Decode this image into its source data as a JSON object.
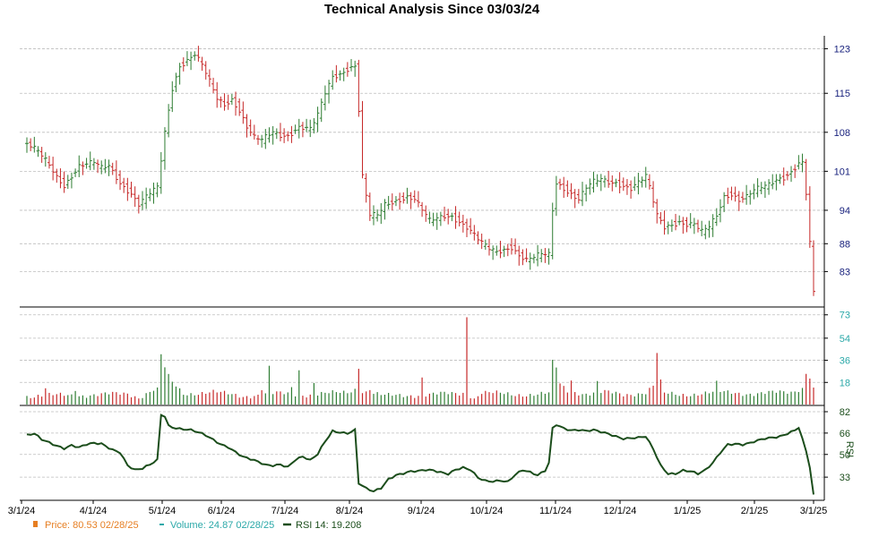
{
  "chart_data": {
    "type": "ohlc",
    "title": "Technical Analysis Since 03/03/24",
    "colors": {
      "up": "#2e7d32",
      "down": "#c62828",
      "volume_axis": "#2aa8a8",
      "price_axis": "#1a237e",
      "rsi_line": "#1b4d1b",
      "grid": "#bdbdbd",
      "legend_price": "#e67e22",
      "legend_volume": "#2aa8a8",
      "legend_rsi": "#1b4d1b"
    },
    "x_axis": {
      "ticks": [
        "3/1/24",
        "4/1/24",
        "5/1/24",
        "6/1/24",
        "7/1/24",
        "8/1/24",
        "9/1/24",
        "10/1/24",
        "11/1/24",
        "12/1/24",
        "1/1/25",
        "2/1/25",
        "3/1/25"
      ]
    },
    "price_axis": {
      "ticks": [
        "123",
        "115",
        "108",
        "101",
        "94",
        "88",
        "83"
      ],
      "tick_values": [
        123,
        115,
        108,
        101,
        94,
        88,
        83
      ],
      "ylim": [
        76.8,
        125
      ]
    },
    "volume_axis": {
      "ticks": [
        "73",
        "54",
        "36",
        "18"
      ],
      "tick_values": [
        73,
        54,
        36,
        18
      ],
      "ylim": [
        0,
        75
      ]
    },
    "rsi_axis": {
      "label": "RSI",
      "ticks": [
        "82",
        "66",
        "50",
        "33"
      ],
      "tick_values": [
        82,
        66,
        50,
        33
      ],
      "ylim": [
        17,
        82
      ]
    },
    "price_anchors": [
      [
        0,
        106
      ],
      [
        3,
        104.5
      ],
      [
        6,
        102
      ],
      [
        8,
        100
      ],
      [
        10,
        98.5
      ],
      [
        14,
        102
      ],
      [
        18,
        102.5
      ],
      [
        20,
        101.5
      ],
      [
        22,
        102
      ],
      [
        25,
        99
      ],
      [
        28,
        97
      ],
      [
        30,
        95
      ],
      [
        33,
        97
      ],
      [
        35,
        98
      ],
      [
        37,
        108
      ],
      [
        39,
        116
      ],
      [
        41,
        120
      ],
      [
        43,
        121
      ],
      [
        45,
        122
      ],
      [
        47,
        120
      ],
      [
        49,
        117
      ],
      [
        51,
        114
      ],
      [
        53,
        113
      ],
      [
        55,
        114
      ],
      [
        57,
        112
      ],
      [
        59,
        109
      ],
      [
        61,
        107
      ],
      [
        63,
        106.5
      ],
      [
        66,
        108
      ],
      [
        68,
        107.5
      ],
      [
        70,
        107.5
      ],
      [
        73,
        109
      ],
      [
        76,
        108.5
      ],
      [
        78,
        111
      ],
      [
        80,
        115
      ],
      [
        82,
        118
      ],
      [
        84,
        118.5
      ],
      [
        86,
        119.5
      ],
      [
        88,
        120
      ],
      [
        89,
        112
      ],
      [
        90,
        100
      ],
      [
        92,
        93
      ],
      [
        94,
        93
      ],
      [
        96,
        95
      ],
      [
        98,
        95.5
      ],
      [
        100,
        96
      ],
      [
        102,
        96.5
      ],
      [
        104,
        96
      ],
      [
        106,
        94
      ],
      [
        108,
        92
      ],
      [
        110,
        92.5
      ],
      [
        112,
        93
      ],
      [
        114,
        93
      ],
      [
        116,
        92
      ],
      [
        118,
        91
      ],
      [
        120,
        89.5
      ],
      [
        122,
        88
      ],
      [
        124,
        87
      ],
      [
        126,
        86.5
      ],
      [
        128,
        87
      ],
      [
        130,
        87.5
      ],
      [
        132,
        86
      ],
      [
        134,
        85
      ],
      [
        136,
        85.5
      ],
      [
        138,
        86
      ],
      [
        140,
        86
      ],
      [
        141,
        94
      ],
      [
        142,
        99
      ],
      [
        144,
        98
      ],
      [
        146,
        97
      ],
      [
        148,
        96
      ],
      [
        150,
        98
      ],
      [
        152,
        99
      ],
      [
        154,
        99.5
      ],
      [
        156,
        99
      ],
      [
        158,
        99
      ],
      [
        160,
        98.5
      ],
      [
        162,
        98
      ],
      [
        164,
        99
      ],
      [
        166,
        100
      ],
      [
        167,
        98
      ],
      [
        169,
        93
      ],
      [
        171,
        91
      ],
      [
        173,
        91.5
      ],
      [
        175,
        92
      ],
      [
        177,
        91.5
      ],
      [
        179,
        91.5
      ],
      [
        181,
        90
      ],
      [
        183,
        91
      ],
      [
        185,
        93
      ],
      [
        187,
        96.5
      ],
      [
        189,
        97
      ],
      [
        191,
        96
      ],
      [
        193,
        96.5
      ],
      [
        195,
        97.5
      ],
      [
        197,
        98
      ],
      [
        199,
        98.5
      ],
      [
        201,
        99.5
      ],
      [
        203,
        100
      ],
      [
        205,
        101
      ],
      [
        207,
        102.5
      ],
      [
        208,
        102.5
      ],
      [
        209,
        97
      ],
      [
        210,
        88
      ],
      [
        211,
        79
      ]
    ],
    "volume_anchors": [
      [
        0,
        7
      ],
      [
        20,
        8
      ],
      [
        27,
        9
      ],
      [
        30,
        6
      ],
      [
        34,
        12
      ],
      [
        36,
        12
      ],
      [
        37,
        27
      ],
      [
        39,
        18
      ],
      [
        42,
        9
      ],
      [
        50,
        10
      ],
      [
        58,
        7
      ],
      [
        63,
        8
      ],
      [
        68,
        9
      ],
      [
        76,
        8
      ],
      [
        86,
        10
      ],
      [
        89,
        14
      ],
      [
        90,
        11
      ],
      [
        96,
        7
      ],
      [
        106,
        8
      ],
      [
        116,
        9
      ],
      [
        118,
        10
      ],
      [
        120,
        5
      ],
      [
        122,
        10
      ],
      [
        130,
        8
      ],
      [
        140,
        9
      ],
      [
        142,
        19
      ],
      [
        145,
        11
      ],
      [
        150,
        9
      ],
      [
        155,
        10
      ],
      [
        160,
        8
      ],
      [
        166,
        10
      ],
      [
        168,
        15
      ],
      [
        170,
        9
      ],
      [
        175,
        8
      ],
      [
        180,
        9
      ],
      [
        186,
        10
      ],
      [
        195,
        9
      ],
      [
        205,
        10
      ],
      [
        209,
        15
      ],
      [
        211,
        13
      ]
    ],
    "volume_spikes": [
      [
        5,
        13
      ],
      [
        13,
        13
      ],
      [
        36,
        40
      ],
      [
        37,
        30
      ],
      [
        63,
        13
      ],
      [
        65,
        30
      ],
      [
        71,
        14
      ],
      [
        73,
        28
      ],
      [
        77,
        18
      ],
      [
        89,
        31
      ],
      [
        92,
        13
      ],
      [
        106,
        22
      ],
      [
        118,
        72
      ],
      [
        141,
        34
      ],
      [
        142,
        30
      ],
      [
        146,
        20
      ],
      [
        153,
        18
      ],
      [
        169,
        42
      ],
      [
        170,
        18
      ],
      [
        185,
        17
      ],
      [
        209,
        26
      ],
      [
        210,
        23
      ]
    ],
    "rsi_anchors": [
      [
        0,
        64
      ],
      [
        2,
        65
      ],
      [
        4,
        61
      ],
      [
        6,
        59
      ],
      [
        8,
        57
      ],
      [
        10,
        55
      ],
      [
        12,
        57
      ],
      [
        14,
        55
      ],
      [
        16,
        57
      ],
      [
        18,
        58
      ],
      [
        20,
        58
      ],
      [
        23,
        54
      ],
      [
        25,
        52
      ],
      [
        27,
        42
      ],
      [
        29,
        38
      ],
      [
        31,
        39
      ],
      [
        33,
        42
      ],
      [
        35,
        46
      ],
      [
        36,
        80
      ],
      [
        37,
        79
      ],
      [
        38,
        72
      ],
      [
        40,
        70
      ],
      [
        42,
        69
      ],
      [
        44,
        68
      ],
      [
        46,
        66
      ],
      [
        48,
        64
      ],
      [
        50,
        61
      ],
      [
        52,
        58
      ],
      [
        54,
        56
      ],
      [
        56,
        52
      ],
      [
        58,
        48
      ],
      [
        60,
        46
      ],
      [
        62,
        44
      ],
      [
        64,
        42
      ],
      [
        66,
        42
      ],
      [
        68,
        43
      ],
      [
        70,
        41
      ],
      [
        72,
        46
      ],
      [
        74,
        48
      ],
      [
        76,
        45
      ],
      [
        78,
        50
      ],
      [
        80,
        60
      ],
      [
        82,
        68
      ],
      [
        84,
        67
      ],
      [
        86,
        66
      ],
      [
        88,
        68
      ],
      [
        89,
        28
      ],
      [
        91,
        24
      ],
      [
        93,
        22
      ],
      [
        95,
        25
      ],
      [
        97,
        32
      ],
      [
        99,
        35
      ],
      [
        101,
        36
      ],
      [
        103,
        37
      ],
      [
        105,
        37
      ],
      [
        107,
        38
      ],
      [
        109,
        38
      ],
      [
        111,
        37
      ],
      [
        113,
        36
      ],
      [
        115,
        39
      ],
      [
        117,
        40
      ],
      [
        119,
        38
      ],
      [
        121,
        32
      ],
      [
        123,
        30
      ],
      [
        125,
        30
      ],
      [
        127,
        31
      ],
      [
        129,
        30
      ],
      [
        131,
        35
      ],
      [
        133,
        38
      ],
      [
        135,
        36
      ],
      [
        137,
        34
      ],
      [
        139,
        38
      ],
      [
        140,
        44
      ],
      [
        141,
        70
      ],
      [
        142,
        73
      ],
      [
        144,
        70
      ],
      [
        146,
        68
      ],
      [
        148,
        68
      ],
      [
        150,
        67
      ],
      [
        152,
        68
      ],
      [
        154,
        67
      ],
      [
        156,
        66
      ],
      [
        158,
        64
      ],
      [
        160,
        62
      ],
      [
        162,
        62
      ],
      [
        164,
        62
      ],
      [
        166,
        63
      ],
      [
        168,
        54
      ],
      [
        170,
        42
      ],
      [
        172,
        36
      ],
      [
        174,
        36
      ],
      [
        176,
        38
      ],
      [
        178,
        37
      ],
      [
        180,
        35
      ],
      [
        182,
        38
      ],
      [
        184,
        44
      ],
      [
        186,
        52
      ],
      [
        188,
        58
      ],
      [
        190,
        58
      ],
      [
        192,
        57
      ],
      [
        194,
        58
      ],
      [
        196,
        60
      ],
      [
        198,
        62
      ],
      [
        200,
        63
      ],
      [
        202,
        64
      ],
      [
        204,
        66
      ],
      [
        206,
        68
      ],
      [
        207,
        70
      ],
      [
        208,
        61
      ],
      [
        209,
        52
      ],
      [
        210,
        40
      ],
      [
        211,
        19
      ]
    ]
  },
  "legend": {
    "price_label": "Price: 80.53  02/28/25",
    "volume_label": "Volume: 24.87  02/28/25",
    "rsi_label": "RSI 14: 19.208"
  }
}
